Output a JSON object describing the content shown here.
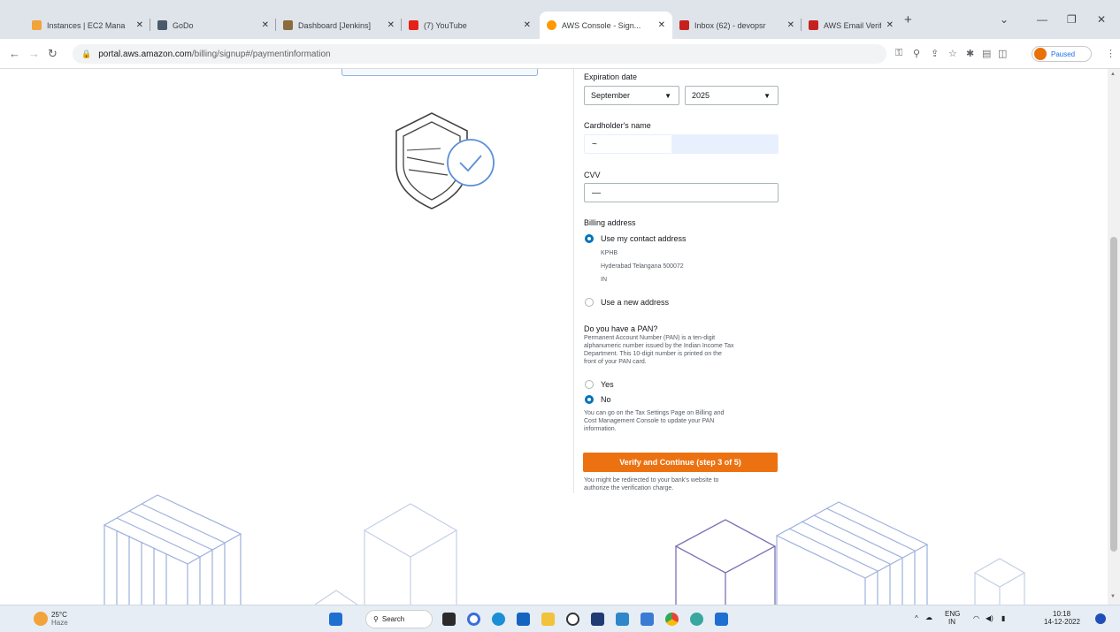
{
  "browser": {
    "tabs": [
      {
        "title": "Instances | EC2 Mana",
        "color": "#f2a33a"
      },
      {
        "title": "GoDo",
        "color": "#4a5a6a"
      },
      {
        "title": "Dashboard [Jenkins]",
        "color": "#8a6d3b"
      },
      {
        "title": "(7) YouTube",
        "color": "#e62117"
      },
      {
        "title": "AWS Console - Sign...",
        "color": "#ff9900"
      },
      {
        "title": "Inbox (62) - devopsr",
        "color": "#c5221f"
      },
      {
        "title": "AWS Email Verificati",
        "color": "#c5221f"
      }
    ],
    "new_tab": "+",
    "url_host": "portal.aws.amazon.com",
    "url_path": "/billing/signup#/paymentinformation",
    "profile_label": "Paused"
  },
  "form": {
    "expiration_label": "Expiration date",
    "exp_month": "September",
    "exp_year": "2025",
    "cardholder_label": "Cardholder's name",
    "cardholder_value": "~",
    "cvv_label": "CVV",
    "cvv_value": "—",
    "billing_label": "Billing address",
    "use_contact": "Use my contact address",
    "address_line1": "KPHB",
    "address_line2": "Hyderabad Telangana 500072",
    "address_line3": "IN",
    "use_new": "Use a new address",
    "pan_question": "Do you have a PAN?",
    "pan_desc_1": "Permanent Account Number (PAN) is a ten-digit",
    "pan_desc_2": "alphanumeric number issued by the Indian Income Tax",
    "pan_desc_3": "Department. This 10-digit number is printed on the",
    "pan_desc_4": "front of your PAN card.",
    "yes_label": "Yes",
    "no_label": "No",
    "tax_note_1": "You can go on the Tax Settings Page on Billing and",
    "tax_note_2": "Cost Management Console to update your PAN",
    "tax_note_3": "information.",
    "verify_button": "Verify and Continue (step 3 of 5)",
    "redirect_1": "You might be redirected to your bank's website to",
    "redirect_2": "authorize the verification charge."
  },
  "taskbar": {
    "weather_temp": "25°C",
    "weather_desc": "Haze",
    "search_label": "Search",
    "lang_1": "ENG",
    "lang_2": "IN",
    "time": "10:18",
    "date": "14-12-2022"
  },
  "colors": {
    "accent": "#ec7211",
    "radio": "#0073bb"
  }
}
